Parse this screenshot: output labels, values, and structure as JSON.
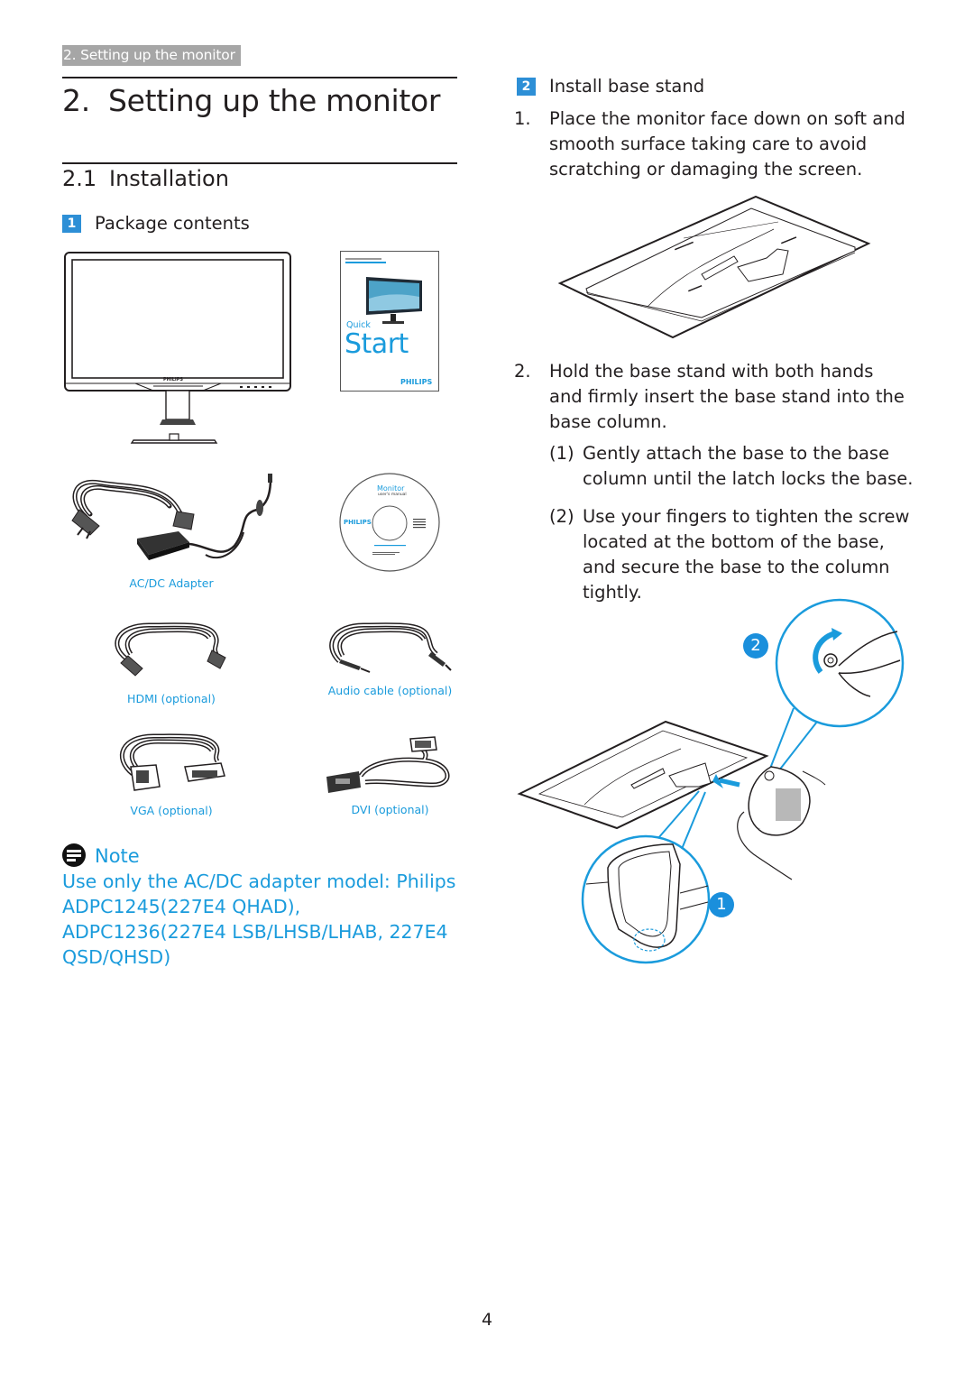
{
  "header": {
    "breadcrumb": "2. Setting up the monitor",
    "chapter_number": "2.",
    "chapter_title": "Setting up the monitor",
    "section_number": "2.1",
    "section_title": "Installation"
  },
  "package_contents": {
    "step_badge": "1",
    "title": "Package contents",
    "items": [
      {
        "name": "monitor",
        "caption": ""
      },
      {
        "name": "quick-start-guide",
        "caption": "",
        "cover_small_text": "Quick",
        "cover_big_text": "Start",
        "cover_brand": "PHILIPS"
      },
      {
        "name": "ac-dc-adapter",
        "caption": "AC/DC Adapter"
      },
      {
        "name": "cd-rom",
        "caption": "",
        "disc_title": "Monitor",
        "disc_subtitle": "user's manual",
        "disc_brand": "PHILIPS"
      },
      {
        "name": "hdmi-cable",
        "caption": "HDMI (optional)"
      },
      {
        "name": "audio-cable",
        "caption": "Audio cable (optional)"
      },
      {
        "name": "vga-cable",
        "caption": "VGA (optional)"
      },
      {
        "name": "dvi-cable",
        "caption": "DVI (optional)"
      }
    ],
    "monitor_brand": "PHILIPS"
  },
  "note": {
    "title": "Note",
    "text": "Use only the AC/DC adapter model: Philips ADPC1245(227E4 QHAD), ADPC1236(227E4 LSB/LHSB/LHAB, 227E4 QSD/QHSD)"
  },
  "install_base": {
    "step_badge": "2",
    "title": "Install base stand",
    "steps": [
      {
        "num": "1.",
        "text": "Place the monitor face down on soft and smooth surface taking care to avoid scratching or damaging the screen."
      },
      {
        "num": "2.",
        "text": "Hold the base stand with both hands and firmly insert the base stand into the base column."
      }
    ],
    "substeps": [
      {
        "num": "(1)",
        "text": "Gently attach the base to the base column until the latch locks the base."
      },
      {
        "num": "(2)",
        "text": "Use your fingers to tighten the screw located at the bottom of the base, and secure the base to the column tightly."
      }
    ],
    "callouts": [
      "1",
      "2"
    ]
  },
  "colors": {
    "accent_blue": "#1a9bdc",
    "badge_blue": "#2d8fd6",
    "breadcrumb_gray": "#a6a6a6",
    "text": "#231f20"
  },
  "footer": {
    "page_number": "4"
  }
}
